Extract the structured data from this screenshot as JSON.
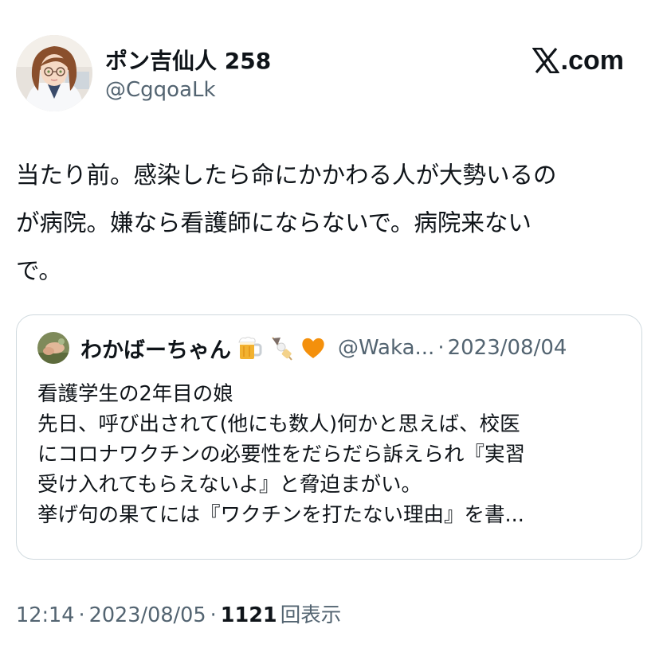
{
  "author": {
    "display_name": "ポン吉仙人 258",
    "handle": "@CgqoaLk"
  },
  "source_label": ".com",
  "tweet": {
    "lines": [
      "当たり前。感染したら命にかかわる人が大勢いるの",
      "が病院。嫌なら看護師にならないで。病院来ない",
      "で。"
    ]
  },
  "quote": {
    "display_name": "わかばーちゃん",
    "emojis": [
      "beer-mug-icon",
      "oden-skewer-icon",
      "orange-heart-icon"
    ],
    "handle": "@Waka...",
    "separator": "·",
    "date": "2023/08/04",
    "lines": [
      "看護学生の2年目の娘",
      "先日、呼び出されて(他にも数人)何かと思えば、校医",
      "にコロナワクチンの必要性をだらだら訴えられ『実習",
      "受け入れてもらえないよ』と脅迫まがい。",
      "挙げ句の果てには『ワクチンを打たない理由』を書..."
    ]
  },
  "meta": {
    "time": "12:14",
    "separator": "·",
    "date": "2023/08/05",
    "views_count": "1121",
    "views_label": "回表示"
  },
  "colors": {
    "text": "#0f1419",
    "secondary": "#536471",
    "border": "#cfd9de",
    "heart": "#f4900c"
  }
}
